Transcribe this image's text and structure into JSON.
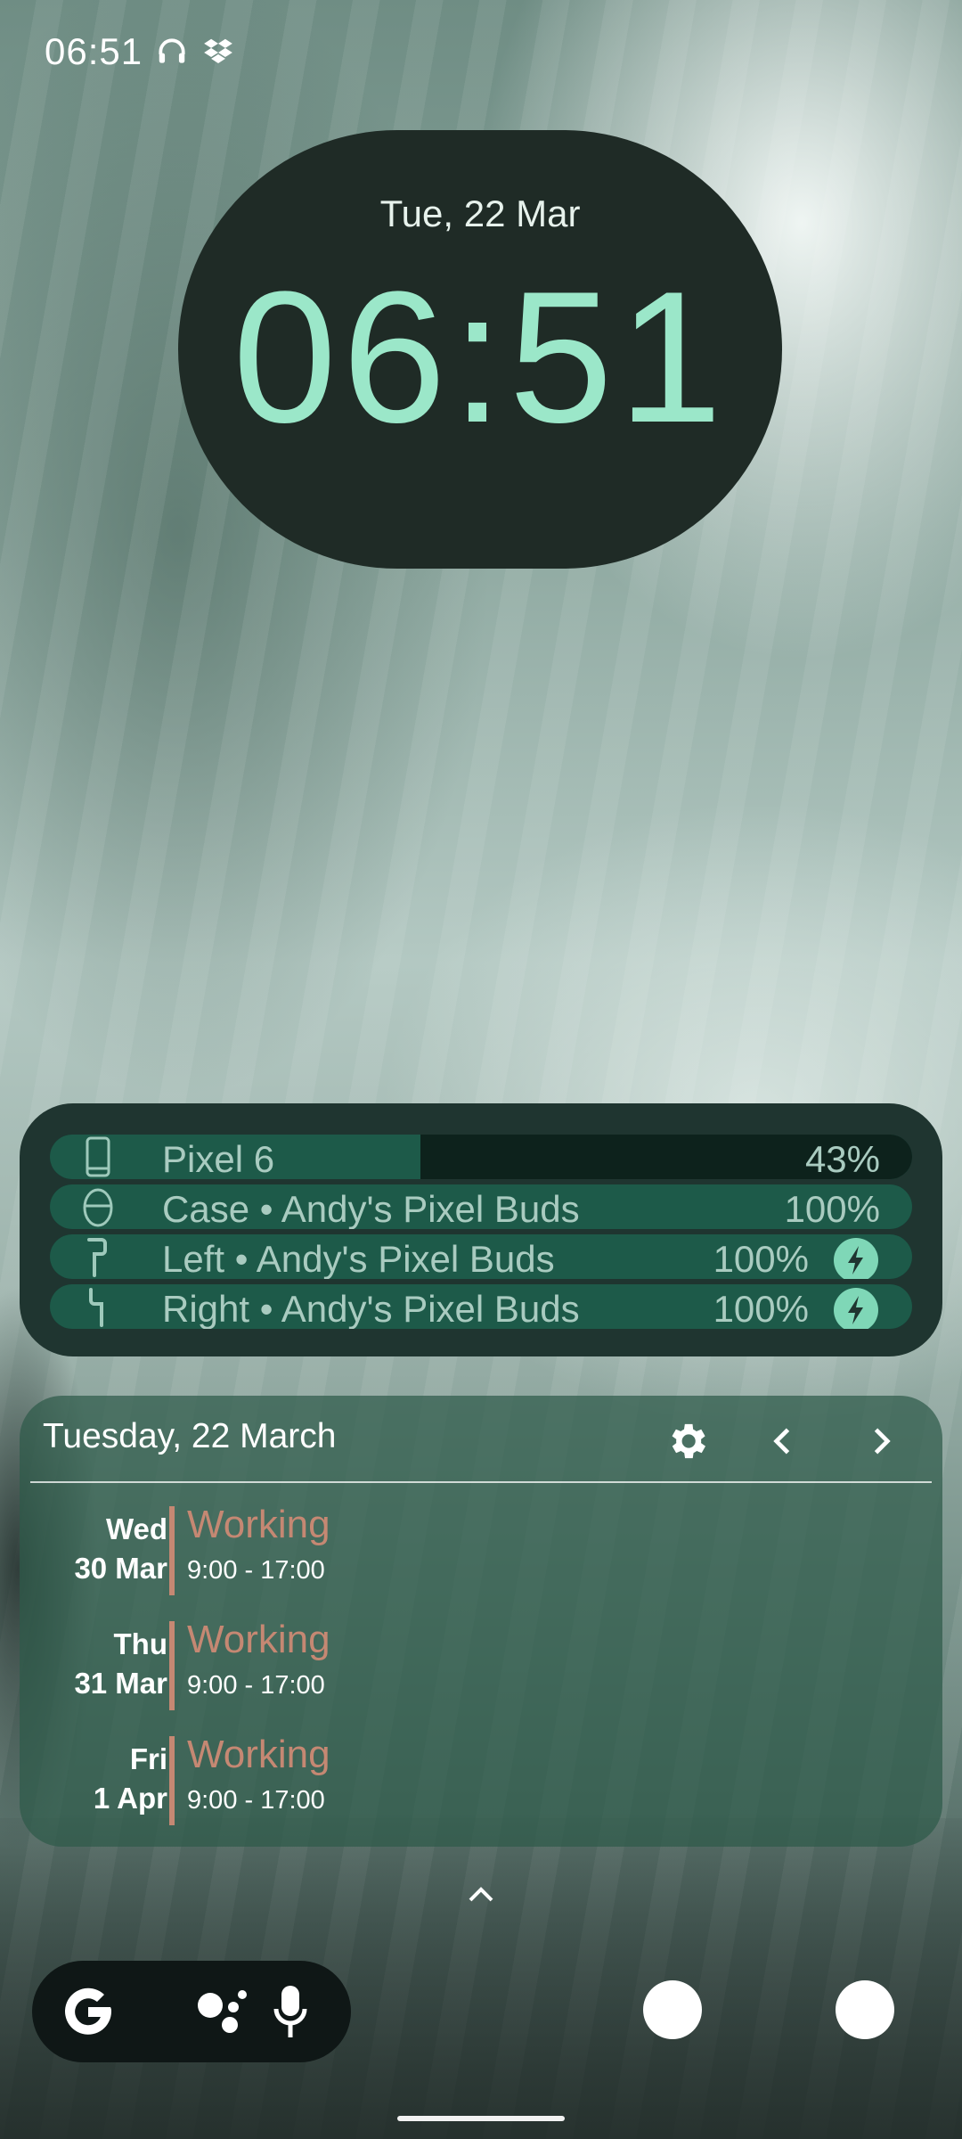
{
  "status_bar": {
    "time": "06:51",
    "icons": [
      "headphones-icon",
      "dropbox-icon"
    ]
  },
  "clock": {
    "date": "Tue, 22 Mar",
    "time": "06:51",
    "colors": {
      "pill": "#1f2b26",
      "time": "#9be7c9"
    }
  },
  "battery": {
    "devices": [
      {
        "name": "Pixel 6",
        "percent": "43%",
        "level": 43,
        "icon": "phone-icon",
        "charging": false
      },
      {
        "name": "Case • Andy's Pixel Buds",
        "percent": "100%",
        "level": 100,
        "icon": "earbuds-case-icon",
        "charging": false
      },
      {
        "name": "Left • Andy's Pixel Buds",
        "percent": "100%",
        "level": 100,
        "icon": "left-earbud-icon",
        "charging": true
      },
      {
        "name": "Right • Andy's Pixel Buds",
        "percent": "100%",
        "level": 100,
        "icon": "right-earbud-icon",
        "charging": true
      }
    ]
  },
  "calendar": {
    "header": "Tuesday, 22 March",
    "buttons": [
      "settings-icon",
      "chevron-left-icon",
      "chevron-right-icon"
    ],
    "events": [
      {
        "weekday": "Wed",
        "date": "30 Mar",
        "title": "Working",
        "time": "9:00 - 17:00"
      },
      {
        "weekday": "Thu",
        "date": "31 Mar",
        "title": "Working",
        "time": "9:00 - 17:00"
      },
      {
        "weekday": "Fri",
        "date": "1 Apr",
        "title": "Working",
        "time": "9:00 - 17:00"
      }
    ],
    "accent_color": "#c58873"
  },
  "dock": {
    "search_icons": [
      "google-g-icon",
      "assistant-icon",
      "microphone-icon"
    ],
    "apps": [
      "app-circle-1",
      "app-circle-2"
    ]
  }
}
